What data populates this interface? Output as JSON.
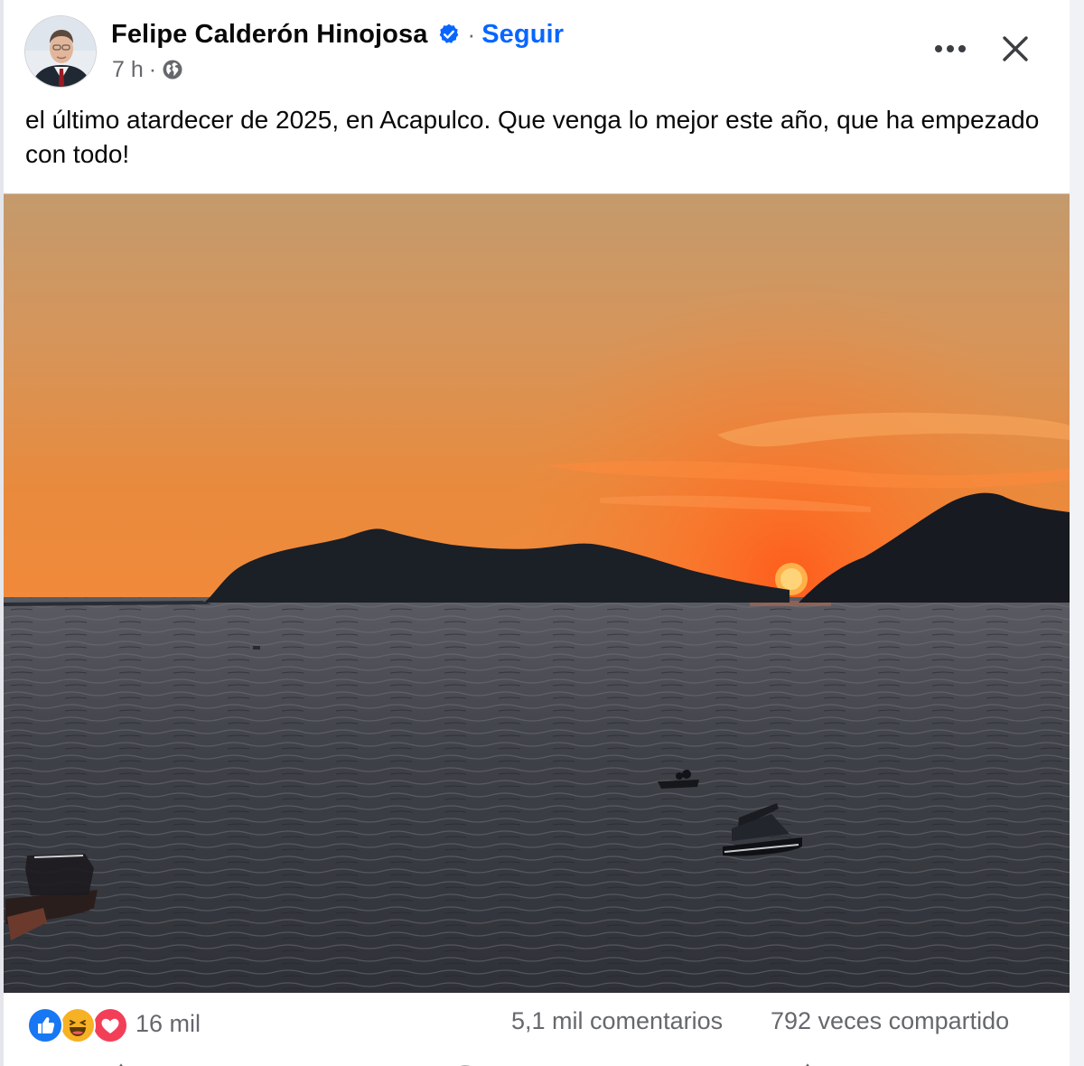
{
  "post": {
    "author": "Felipe Calderón Hinojosa",
    "separator": "·",
    "follow_label": "Seguir",
    "time": "7 h",
    "meta_separator": "·",
    "caption": "el último atardecer de 2025, en Acapulco. Que venga lo mejor este año, que ha empezado con todo!"
  },
  "icons": {
    "verified": "verified-badge-icon",
    "audience": "globe-icon",
    "more": "more-options-icon",
    "close": "close-icon"
  },
  "footer": {
    "reactions_count": "16 mil",
    "reaction_types": [
      "like",
      "haha",
      "love"
    ],
    "comments": "5,1 mil comentarios",
    "shares": "792 veces compartido"
  },
  "colors": {
    "accent": "#0866ff",
    "secondary_text": "#65686c",
    "like": "#1877f2",
    "love": "#f33e58",
    "haha": "#f7b125"
  }
}
